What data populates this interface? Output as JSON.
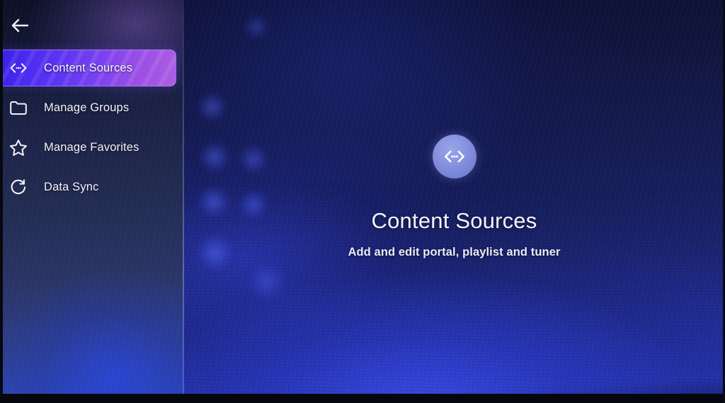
{
  "app": {
    "back_button_label": "Back"
  },
  "sidebar": {
    "items": [
      {
        "id": "content-sources",
        "label": "Content Sources",
        "icon": "code-brackets-icon",
        "selected": true
      },
      {
        "id": "manage-groups",
        "label": "Manage Groups",
        "icon": "folder-icon",
        "selected": false
      },
      {
        "id": "manage-favorites",
        "label": "Manage Favorites",
        "icon": "star-icon",
        "selected": false
      },
      {
        "id": "data-sync",
        "label": "Data Sync",
        "icon": "refresh-icon",
        "selected": false
      }
    ]
  },
  "main": {
    "icon": "code-brackets-icon",
    "title": "Content Sources",
    "subtitle": "Add and edit portal, playlist and tuner"
  },
  "colors": {
    "selected_gradient_start": "#3a1fe6",
    "selected_gradient_end": "#ad5ee0",
    "sidebar_bg_top": "#0d1026",
    "sidebar_bg_bottom": "#2b47b8",
    "main_bg_top": "#0c1030",
    "main_bg_glow": "#2735b4",
    "hero_circle": "#8490dd",
    "text_primary": "#f4f5fb"
  }
}
